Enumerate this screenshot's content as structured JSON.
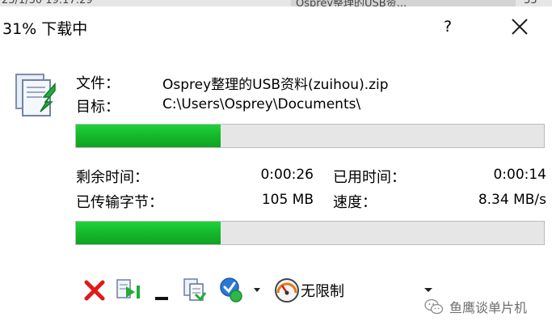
{
  "background": {
    "left_fragment": "23/1/30  19:17:29",
    "tab_fragment": "Osprey整理的USB资...",
    "right_fragment": "33"
  },
  "window": {
    "title": "31% 下载中",
    "help_glyph": "?",
    "progress_percent": 31
  },
  "file_info": {
    "file_label": "文件：",
    "file_value": "Osprey整理的USB资料(zuihou).zip",
    "target_label": "目标：",
    "target_value": "C:\\Users\\Osprey\\Documents\\"
  },
  "stats": {
    "remaining_label": "剩余时间：",
    "remaining_value": "0:00:26",
    "elapsed_label": "已用时间：",
    "elapsed_value": "0:00:14",
    "transferred_label": "已传输字节：",
    "transferred_value": "105 MB",
    "speed_label": "速度：",
    "speed_value": "8.34 MB/s"
  },
  "toolbar": {
    "speed_limit_label": "无限制",
    "icons": [
      "cancel-icon",
      "pause-resume-icon",
      "minimize-icon",
      "copy-icon",
      "options-icon",
      "speed-gauge-icon"
    ]
  },
  "watermark": {
    "text": "鱼鹰谈单片机"
  },
  "colors": {
    "progress_fill": "#14b82b",
    "progress_track": "#e6e6e6"
  }
}
